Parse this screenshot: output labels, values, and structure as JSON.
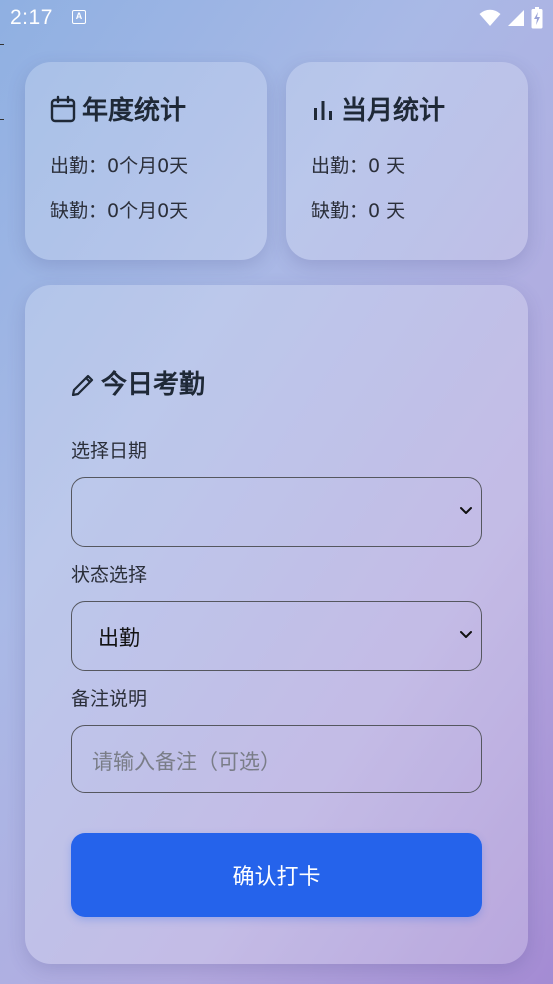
{
  "status_bar": {
    "time": "2:17",
    "notification_glyph": "A"
  },
  "year_card": {
    "title": "年度统计",
    "icon": "calendar-icon",
    "attendance": "出勤：0个月0天",
    "absence": "缺勤：0个月0天"
  },
  "month_card": {
    "title": "当月统计",
    "icon": "bar-chart-icon",
    "attendance": "出勤：0 天",
    "absence": "缺勤：0 天"
  },
  "form": {
    "title": "今日考勤",
    "icon": "pencil-icon",
    "date_label": "选择日期",
    "date_value": "",
    "status_label": "状态选择",
    "status_value": "出勤",
    "note_label": "备注说明",
    "note_placeholder": "请输入备注（可选）",
    "submit_label": "确认打卡"
  },
  "colors": {
    "accent": "#2563eb",
    "text": "#1f2937"
  }
}
